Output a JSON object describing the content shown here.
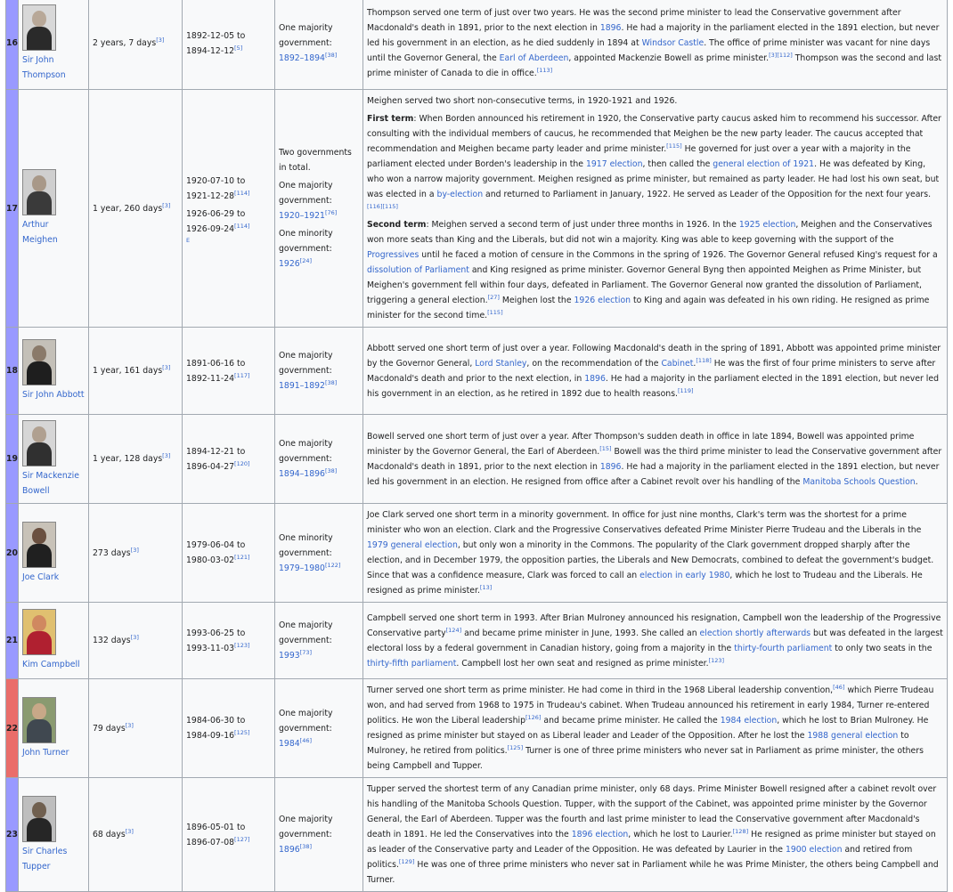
{
  "colors": {
    "conservative": "#9999ff",
    "liberal": "#ea6d6a",
    "link": "#3366cc",
    "border": "#a2a9b1"
  },
  "rows": [
    {
      "num": "16",
      "party": "conservative",
      "name": "Sir John Thompson",
      "portrait_icon": "portrait-photo",
      "length": "2 years, 7 days",
      "length_ref": "[3]",
      "dates": [
        "1892-12-05 to",
        "1894-12-12"
      ],
      "dates_ref": "[5]",
      "gov": {
        "intro": "",
        "items": [
          {
            "label": "One majority government:",
            "years": "1892–1894",
            "ref": "[38]"
          }
        ]
      },
      "desc_html": "Thompson served one term of just over two years. He was the second prime minister to lead the Conservative government after Macdonald's death in 1891, prior to the next election in <a>1896</a>. He had a majority in the parliament elected in the 1891 election, but never led his government in an election, as he died suddenly in 1894 at <a>Windsor Castle</a>. The office of prime minister was vacant for nine days until the Governor General, the <a>Earl of Aberdeen</a>, appointed Mackenzie Bowell as prime minister.<sup>[3][112]</sup> Thompson was the second and last prime minister of Canada to die in office.<sup>[113]</sup>"
    },
    {
      "num": "17",
      "party": "conservative",
      "name": "Arthur Meighen",
      "portrait_icon": "portrait-photo",
      "length": "1 year, 260 days",
      "length_ref": "[3]",
      "dates": [
        "1920-07-10 to",
        "1921-12-28"
      ],
      "dates_ref": "[114]",
      "dates2": [
        "1926-06-29 to",
        "1926-09-24"
      ],
      "dates2_ref": "[114]",
      "dates2_extra": "E",
      "gov": {
        "intro": "Two governments in total.",
        "items": [
          {
            "label": "One majority government:",
            "years": "1920–1921",
            "ref": "[76]"
          },
          {
            "label": "One minority government:",
            "years": "1926",
            "ref": "[24]"
          }
        ]
      },
      "desc_html": "<p>Meighen served two short non-consecutive terms, in 1920-1921 and 1926.</p><p><b>First term</b>: When Borden announced his retirement in 1920, the Conservative party caucus asked him to recommend his successor. After consulting with the individual members of caucus, he recommended that Meighen be the new party leader. The caucus accepted that recommendation and Meighen became party leader and prime minister.<sup>[115]</sup> He governed for just over a year with a majority in the parliament elected under Borden's leadership in the <a>1917 election</a>, then called the <a>general election of 1921</a>. He was defeated by King, who won a narrow majority government. Meighen resigned as prime minister, but remained as party leader. He had lost his own seat, but was elected in a <a>by-election</a> and returned to Parliament in January, 1922. He served as Leader of the Opposition for the next four years.<sup>[116][115]</sup><br><b>Second term</b>: Meighen served a second term of just under three months in 1926. In the <a>1925 election</a>, Meighen and the Conservatives won more seats than King and the Liberals, but did not win a majority. King was able to keep governing with the support of the <a>Progressives</a> until he faced a motion of censure in the Commons in the spring of 1926. The Governor General refused King's request for a <a>dissolution of Parliament</a> and King resigned as prime minister. Governor General Byng then appointed Meighen as Prime Minister, but Meighen's government fell within four days, defeated in Parliament. The Governor General now granted the dissolution of Parliament, triggering a general election.<sup>[27]</sup> Meighen lost the <a>1926 election</a> to King and again was defeated in his own riding. He resigned as prime minister for the second time.<sup>[115]</sup></p>"
    },
    {
      "num": "18",
      "party": "conservative",
      "name": "Sir John Abbott",
      "portrait_icon": "portrait-photo",
      "length": "1 year, 161 days",
      "length_ref": "[3]",
      "dates": [
        "1891-06-16 to",
        "1892-11-24"
      ],
      "dates_ref": "[117]",
      "gov": {
        "intro": "",
        "items": [
          {
            "label": "One majority government:",
            "years": "1891–1892",
            "ref": "[38]"
          }
        ]
      },
      "desc_html": "Abbott served one short term of just over a year. Following Macdonald's death in the spring of 1891, Abbott was appointed prime minister by the Governor General, <a>Lord Stanley</a>, on the recommendation of the <a>Cabinet</a>.<sup>[118]</sup> He was the first of four prime ministers to serve after Macdonald's death and prior to the next election, in <a>1896</a>. He had a majority in the parliament elected in the 1891 election, but never led his government in an election, as he retired in 1892 due to health reasons.<sup>[119]</sup>"
    },
    {
      "num": "19",
      "party": "conservative",
      "name": "Sir Mackenzie Bowell",
      "portrait_icon": "portrait-photo",
      "length": "1 year, 128 days",
      "length_ref": "[3]",
      "dates": [
        "1894-12-21 to",
        "1896-04-27"
      ],
      "dates_ref": "[120]",
      "gov": {
        "intro": "",
        "items": [
          {
            "label": "One majority government:",
            "years": "1894–1896",
            "ref": "[38]"
          }
        ]
      },
      "desc_html": "Bowell served one short term of just over a year. After Thompson's sudden death in office in late 1894, Bowell was appointed prime minister by the Governor General, the Earl of Aberdeen.<sup>[15]</sup> Bowell was the third prime minister to lead the Conservative government after Macdonald's death in 1891, prior to the next election in <a>1896</a>. He had a majority in the parliament elected in the 1891 election, but never led his government in an election. He resigned from office after a Cabinet revolt over his handling of the <a>Manitoba Schools Question</a>."
    },
    {
      "num": "20",
      "party": "conservative",
      "name": "Joe Clark",
      "portrait_icon": "portrait-photo",
      "length": "273 days",
      "length_ref": "[3]",
      "dates": [
        "1979-06-04 to",
        "1980-03-02"
      ],
      "dates_ref": "[121]",
      "gov": {
        "intro": "",
        "items": [
          {
            "label": "One minority government:",
            "years": "1979–1980",
            "ref": "[122]"
          }
        ]
      },
      "desc_html": "Joe Clark served one short term in a minority government. In office for just nine months, Clark's term was the shortest for a prime minister who won an election. Clark and the Progressive Conservatives defeated Prime Minister Pierre Trudeau and the Liberals in the <a>1979 general election</a>, but only won a minority in the Commons. The popularity of the Clark government dropped sharply after the election, and in December 1979, the opposition parties, the Liberals and New Democrats, combined to defeat the government's budget. Since that was a confidence measure, Clark was forced to call an <a>election in early 1980</a>, which he lost to Trudeau and the Liberals. He resigned as prime minister.<sup>[13]</sup>"
    },
    {
      "num": "21",
      "party": "conservative",
      "name": "Kim Campbell",
      "portrait_icon": "portrait-photo",
      "length": "132 days",
      "length_ref": "[3]",
      "dates": [
        "1993-06-25 to",
        "1993-11-03"
      ],
      "dates_ref": "[123]",
      "gov": {
        "intro": "",
        "items": [
          {
            "label": "One majority government:",
            "years": "1993",
            "ref": "[73]"
          }
        ]
      },
      "desc_html": "Campbell served one short term in 1993. After Brian Mulroney announced his resignation, Campbell won the leadership of the Progressive Conservative party<sup>[124]</sup> and became prime minister in June, 1993. She called an <a>election shortly afterwards</a> but was defeated in the largest electoral loss by a federal government in Canadian history, going from a majority in the <a>thirty-fourth parliament</a> to only two seats in the <a>thirty-fifth parliament</a>. Campbell lost her own seat and resigned as prime minister.<sup>[123]</sup>"
    },
    {
      "num": "22",
      "party": "liberal",
      "name": "John Turner",
      "portrait_icon": "portrait-photo",
      "length": "79 days",
      "length_ref": "[3]",
      "dates": [
        "1984-06-30 to",
        "1984-09-16"
      ],
      "dates_ref": "[125]",
      "gov": {
        "intro": "",
        "items": [
          {
            "label": "One majority government:",
            "years": "1984",
            "ref": "[46]"
          }
        ]
      },
      "desc_html": "Turner served one short term as prime minister. He had come in third in the 1968 Liberal leadership convention,<sup>[46]</sup> which Pierre Trudeau won, and had served from 1968 to 1975 in Trudeau's cabinet. When Trudeau announced his retirement in early 1984, Turner re-entered politics. He won the Liberal leadership<sup>[126]</sup> and became prime minister. He called the <a>1984 election</a>, which he lost to Brian Mulroney. He resigned as prime minister but stayed on as Liberal leader and Leader of the Opposition. After he lost the <a>1988 general election</a> to Mulroney, he retired from politics.<sup>[125]</sup> Turner is one of three prime ministers who never sat in Parliament as prime minister, the others being Campbell and Tupper."
    },
    {
      "num": "23",
      "party": "conservative",
      "name": "Sir Charles Tupper",
      "portrait_icon": "portrait-photo",
      "length": "68 days",
      "length_ref": "[3]",
      "dates": [
        "1896-05-01 to",
        "1896-07-08"
      ],
      "dates_ref": "[127]",
      "gov": {
        "intro": "",
        "items": [
          {
            "label": "One majority government:",
            "years": "1896",
            "ref": "[38]"
          }
        ]
      },
      "desc_html": "Tupper served the shortest term of any Canadian prime minister, only 68 days. Prime Minister Bowell resigned after a cabinet revolt over his handling of the Manitoba Schools Question. Tupper, with the support of the Cabinet, was appointed prime minister by the Governor General, the Earl of Aberdeen. Tupper was the fourth and last prime minister to lead the Conservative government after Macdonald's death in 1891. He led the Conservatives into the <a>1896 election</a>, which he lost to Laurier.<sup>[128]</sup> He resigned as prime minister but stayed on as leader of the Conservative party and Leader of the Opposition. He was defeated by Laurier in the <a>1900 election</a> and retired from politics.<sup>[129]</sup> He was one of three prime ministers who never sat in Parliament while he was Prime Minister, the others being Campbell and Turner."
    }
  ]
}
